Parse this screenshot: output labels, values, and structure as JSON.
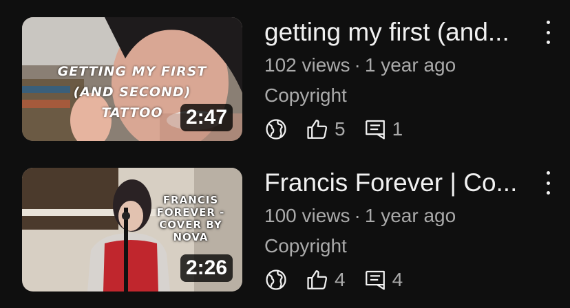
{
  "videos": [
    {
      "overlay": "GETTING MY FIRST (AND SECOND) TATTOO",
      "duration": "2:47",
      "title": "getting my first (and...",
      "views": "102 views",
      "age": "1 year ago",
      "restriction": "Copyright",
      "visibility_icon": "globe-icon",
      "likes": "5",
      "comments": "1"
    },
    {
      "overlay": "FRANCIS FOREVER - COVER BY NOVA",
      "duration": "2:26",
      "title": "Francis Forever | Co...",
      "views": "100 views",
      "age": "1 year ago",
      "restriction": "Copyright",
      "visibility_icon": "globe-icon",
      "likes": "4",
      "comments": "4"
    }
  ],
  "meta_separator": "·",
  "colors": {
    "background": "#0f0f0f",
    "title": "#f1f1f1",
    "secondary": "#aaaaaa"
  }
}
